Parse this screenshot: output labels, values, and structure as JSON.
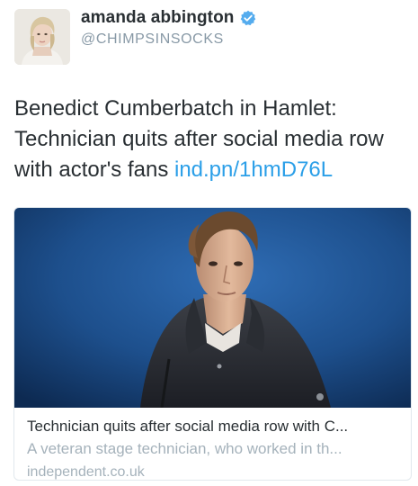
{
  "author": {
    "display_name": "amanda abbington",
    "handle": "@CHIMPSINSOCKS",
    "verified": true,
    "avatar_icon": "profile-photo",
    "verified_icon": "verified-badge-icon"
  },
  "tweet": {
    "text": "Benedict Cumberbatch in Hamlet: Technician quits after social media row with actor's fans ",
    "link": "ind.pn/1hmD76L"
  },
  "card": {
    "title": "Technician quits after social media row with C...",
    "description": "A veteran stage technician, who worked in th...",
    "domain": "independent.co.uk"
  },
  "colors": {
    "link": "#2b9fe8",
    "verified": "#55acee",
    "muted": "#a5b2bb",
    "card_background": "#1f4f86"
  }
}
